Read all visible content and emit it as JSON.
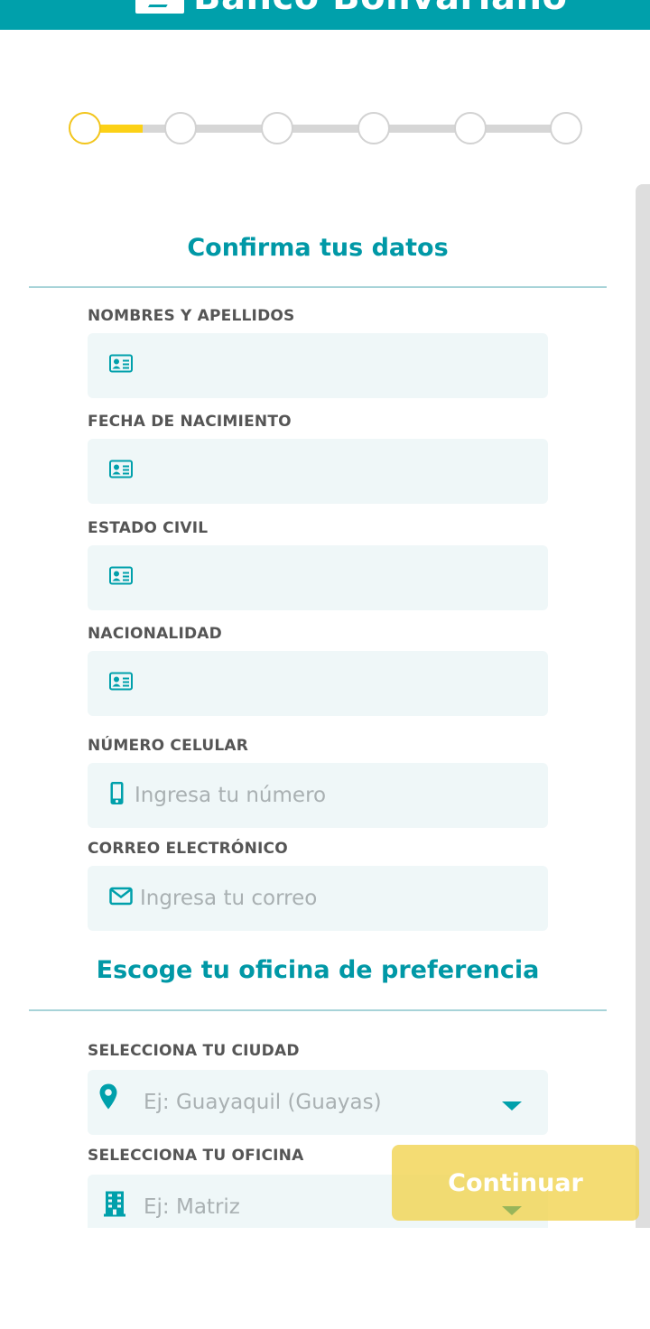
{
  "header": {
    "brand": "Banco Bolivariano",
    "color": "#00a0ab"
  },
  "stepper": {
    "total_steps": 6,
    "current_step": 1,
    "progress_in_first_segment": 0.6,
    "active_color": "#fcd116"
  },
  "personal": {
    "title": "Confirma tus datos",
    "fields": [
      {
        "label": "NOMBRES Y APELLIDOS",
        "icon": "id-card-icon",
        "value": ""
      },
      {
        "label": "FECHA DE NACIMIENTO",
        "icon": "id-card-icon",
        "value": ""
      },
      {
        "label": "ESTADO CIVIL",
        "icon": "id-card-icon",
        "value": ""
      },
      {
        "label": "NACIONALIDAD",
        "icon": "id-card-icon",
        "value": ""
      },
      {
        "label": "NÚMERO CELULAR",
        "icon": "mobile-phone-icon",
        "placeholder": "Ingresa tu número"
      },
      {
        "label": "CORREO ELECTRÓNICO",
        "icon": "envelope-icon",
        "placeholder": "Ingresa tu correo"
      }
    ]
  },
  "office": {
    "title": "Escoge tu oficina de preferencia",
    "city": {
      "label": "SELECCIONA TU CIUDAD",
      "icon": "map-pin-icon",
      "placeholder": "Ej: Guayaquil (Guayas)"
    },
    "branch": {
      "label": "SELECCIONA TU OFICINA",
      "icon": "building-icon",
      "placeholder": "Ej: Matriz"
    }
  },
  "actions": {
    "continue_label": "Continuar",
    "accent": "#f2d454"
  }
}
